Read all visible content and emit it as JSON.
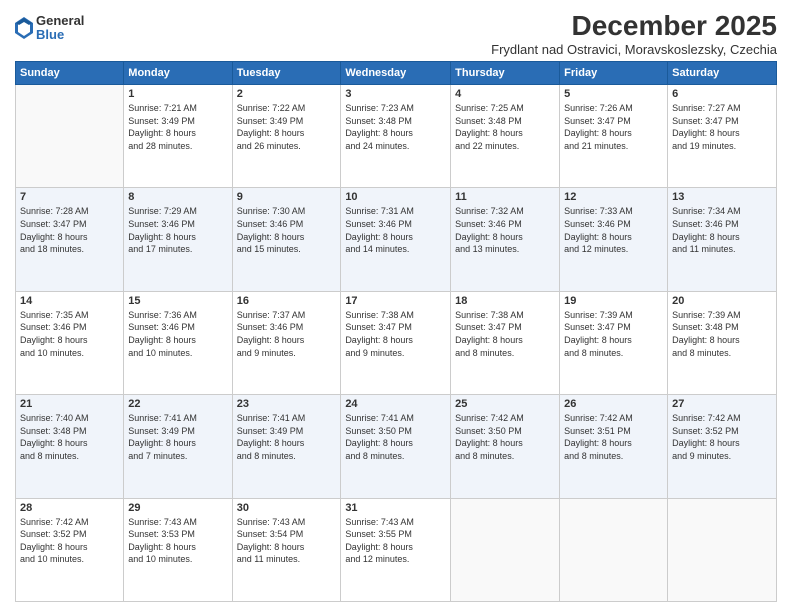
{
  "logo": {
    "general": "General",
    "blue": "Blue"
  },
  "title": "December 2025",
  "subtitle": "Frydlant nad Ostravici, Moravskoslezsky, Czechia",
  "headers": [
    "Sunday",
    "Monday",
    "Tuesday",
    "Wednesday",
    "Thursday",
    "Friday",
    "Saturday"
  ],
  "weeks": [
    [
      {
        "day": "",
        "content": ""
      },
      {
        "day": "1",
        "content": "Sunrise: 7:21 AM\nSunset: 3:49 PM\nDaylight: 8 hours\nand 28 minutes."
      },
      {
        "day": "2",
        "content": "Sunrise: 7:22 AM\nSunset: 3:49 PM\nDaylight: 8 hours\nand 26 minutes."
      },
      {
        "day": "3",
        "content": "Sunrise: 7:23 AM\nSunset: 3:48 PM\nDaylight: 8 hours\nand 24 minutes."
      },
      {
        "day": "4",
        "content": "Sunrise: 7:25 AM\nSunset: 3:48 PM\nDaylight: 8 hours\nand 22 minutes."
      },
      {
        "day": "5",
        "content": "Sunrise: 7:26 AM\nSunset: 3:47 PM\nDaylight: 8 hours\nand 21 minutes."
      },
      {
        "day": "6",
        "content": "Sunrise: 7:27 AM\nSunset: 3:47 PM\nDaylight: 8 hours\nand 19 minutes."
      }
    ],
    [
      {
        "day": "7",
        "content": "Sunrise: 7:28 AM\nSunset: 3:47 PM\nDaylight: 8 hours\nand 18 minutes."
      },
      {
        "day": "8",
        "content": "Sunrise: 7:29 AM\nSunset: 3:46 PM\nDaylight: 8 hours\nand 17 minutes."
      },
      {
        "day": "9",
        "content": "Sunrise: 7:30 AM\nSunset: 3:46 PM\nDaylight: 8 hours\nand 15 minutes."
      },
      {
        "day": "10",
        "content": "Sunrise: 7:31 AM\nSunset: 3:46 PM\nDaylight: 8 hours\nand 14 minutes."
      },
      {
        "day": "11",
        "content": "Sunrise: 7:32 AM\nSunset: 3:46 PM\nDaylight: 8 hours\nand 13 minutes."
      },
      {
        "day": "12",
        "content": "Sunrise: 7:33 AM\nSunset: 3:46 PM\nDaylight: 8 hours\nand 12 minutes."
      },
      {
        "day": "13",
        "content": "Sunrise: 7:34 AM\nSunset: 3:46 PM\nDaylight: 8 hours\nand 11 minutes."
      }
    ],
    [
      {
        "day": "14",
        "content": "Sunrise: 7:35 AM\nSunset: 3:46 PM\nDaylight: 8 hours\nand 10 minutes."
      },
      {
        "day": "15",
        "content": "Sunrise: 7:36 AM\nSunset: 3:46 PM\nDaylight: 8 hours\nand 10 minutes."
      },
      {
        "day": "16",
        "content": "Sunrise: 7:37 AM\nSunset: 3:46 PM\nDaylight: 8 hours\nand 9 minutes."
      },
      {
        "day": "17",
        "content": "Sunrise: 7:38 AM\nSunset: 3:47 PM\nDaylight: 8 hours\nand 9 minutes."
      },
      {
        "day": "18",
        "content": "Sunrise: 7:38 AM\nSunset: 3:47 PM\nDaylight: 8 hours\nand 8 minutes."
      },
      {
        "day": "19",
        "content": "Sunrise: 7:39 AM\nSunset: 3:47 PM\nDaylight: 8 hours\nand 8 minutes."
      },
      {
        "day": "20",
        "content": "Sunrise: 7:39 AM\nSunset: 3:48 PM\nDaylight: 8 hours\nand 8 minutes."
      }
    ],
    [
      {
        "day": "21",
        "content": "Sunrise: 7:40 AM\nSunset: 3:48 PM\nDaylight: 8 hours\nand 8 minutes."
      },
      {
        "day": "22",
        "content": "Sunrise: 7:41 AM\nSunset: 3:49 PM\nDaylight: 8 hours\nand 7 minutes."
      },
      {
        "day": "23",
        "content": "Sunrise: 7:41 AM\nSunset: 3:49 PM\nDaylight: 8 hours\nand 8 minutes."
      },
      {
        "day": "24",
        "content": "Sunrise: 7:41 AM\nSunset: 3:50 PM\nDaylight: 8 hours\nand 8 minutes."
      },
      {
        "day": "25",
        "content": "Sunrise: 7:42 AM\nSunset: 3:50 PM\nDaylight: 8 hours\nand 8 minutes."
      },
      {
        "day": "26",
        "content": "Sunrise: 7:42 AM\nSunset: 3:51 PM\nDaylight: 8 hours\nand 8 minutes."
      },
      {
        "day": "27",
        "content": "Sunrise: 7:42 AM\nSunset: 3:52 PM\nDaylight: 8 hours\nand 9 minutes."
      }
    ],
    [
      {
        "day": "28",
        "content": "Sunrise: 7:42 AM\nSunset: 3:52 PM\nDaylight: 8 hours\nand 10 minutes."
      },
      {
        "day": "29",
        "content": "Sunrise: 7:43 AM\nSunset: 3:53 PM\nDaylight: 8 hours\nand 10 minutes."
      },
      {
        "day": "30",
        "content": "Sunrise: 7:43 AM\nSunset: 3:54 PM\nDaylight: 8 hours\nand 11 minutes."
      },
      {
        "day": "31",
        "content": "Sunrise: 7:43 AM\nSunset: 3:55 PM\nDaylight: 8 hours\nand 12 minutes."
      },
      {
        "day": "",
        "content": ""
      },
      {
        "day": "",
        "content": ""
      },
      {
        "day": "",
        "content": ""
      }
    ]
  ]
}
